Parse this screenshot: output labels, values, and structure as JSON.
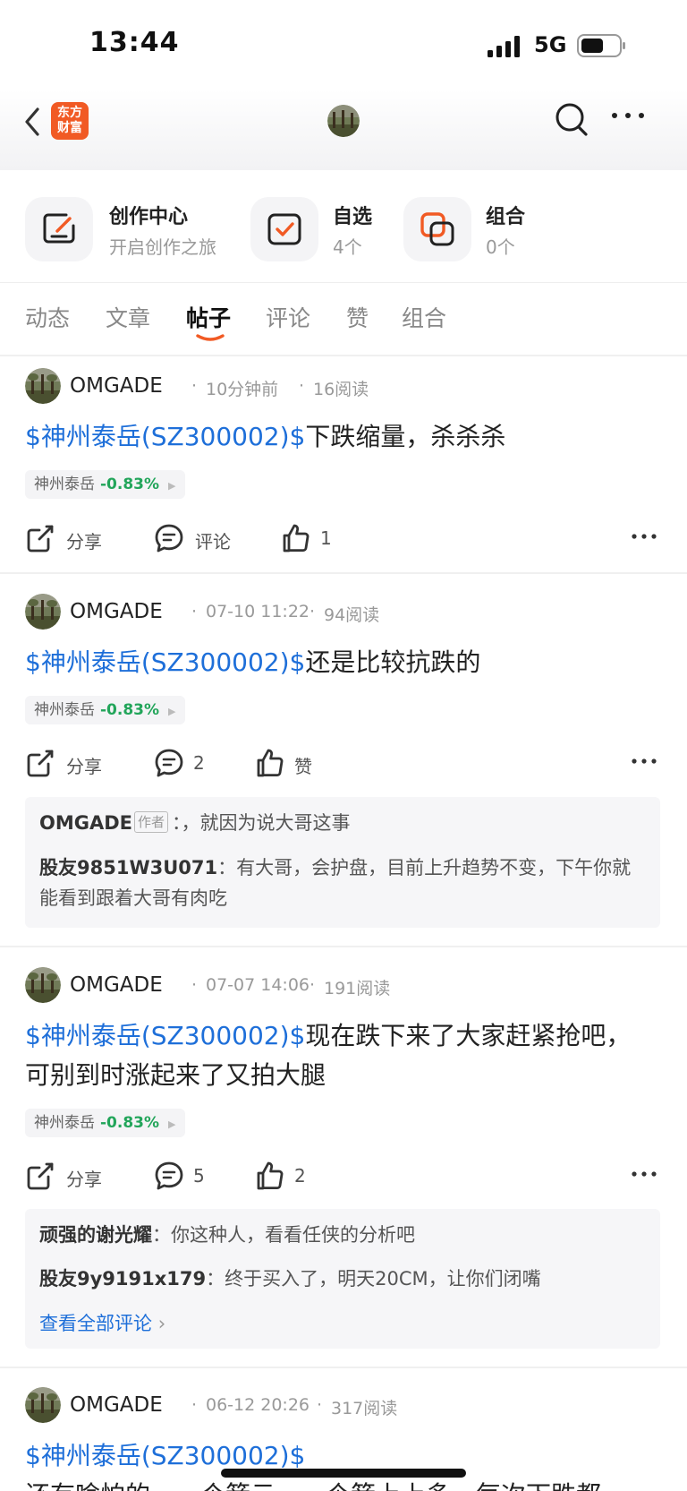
{
  "status_bar": {
    "time": "13:44",
    "network": "5G"
  },
  "header": {
    "logo_text_line1": "东方",
    "logo_text_line2": "财富"
  },
  "quick_entries": [
    {
      "title": "创作中心",
      "subtitle": "开启创作之旅",
      "icon": "creation-icon"
    },
    {
      "title": "自选",
      "subtitle": "4个",
      "icon": "watchlist-check-icon"
    },
    {
      "title": "组合",
      "subtitle": "0个",
      "icon": "portfolio-icon"
    }
  ],
  "tabs": [
    "动态",
    "文章",
    "帖子",
    "评论",
    "赞",
    "组合"
  ],
  "active_tab": "帖子",
  "colors": {
    "accent_orange": "#f15a24",
    "link_blue": "#1e6fd9",
    "down_green": "#22a55a"
  },
  "posts": [
    {
      "user": "OMGADE",
      "time": "10分钟前",
      "reads": "16阅读",
      "stock_link": "$神州泰岳(SZ300002)$",
      "text": "下跌缩量，杀杀杀",
      "chip_name": "神州泰岳",
      "chip_change": "-0.83%",
      "share": "分享",
      "comment": "评论",
      "like": "1"
    },
    {
      "user": "OMGADE",
      "time": "07-10 11:22",
      "reads": "94阅读",
      "stock_link": "$神州泰岳(SZ300002)$",
      "text": "还是比较抗跌的",
      "chip_name": "神州泰岳",
      "chip_change": "-0.83%",
      "share": "分享",
      "comment": "2",
      "like": "赞",
      "comments": [
        {
          "user": "OMGADE",
          "tag": "作者",
          "text": "：，就因为说大哥这事"
        },
        {
          "user": "股友9851W3U071",
          "text": "：有大哥，会护盘，目前上升趋势不变，下午你就能看到跟着大哥有肉吃"
        }
      ]
    },
    {
      "user": "OMGADE",
      "time": "07-07 14:06",
      "reads": "191阅读",
      "stock_link": "$神州泰岳(SZ300002)$",
      "text": "现在跌下来了大家赶紧抢吧，可别到时涨起来了又拍大腿",
      "chip_name": "神州泰岳",
      "chip_change": "-0.83%",
      "share": "分享",
      "comment": "5",
      "like": "2",
      "comments": [
        {
          "user": "顽强的谢光耀",
          "text": "：你这种人，看看任侠的分析吧"
        },
        {
          "user": "股友9y9191x179",
          "text": "：终于买入了，明天20CM，让你们闭嘴"
        }
      ],
      "view_all": "查看全部评论"
    },
    {
      "user": "OMGADE",
      "time": "06-12 20:26",
      "reads": "317阅读",
      "stock_link": "$神州泰岳(SZ300002)$",
      "text": "还有啥怕的，一个箭云，一个箭上上多，每次下跌都"
    }
  ]
}
